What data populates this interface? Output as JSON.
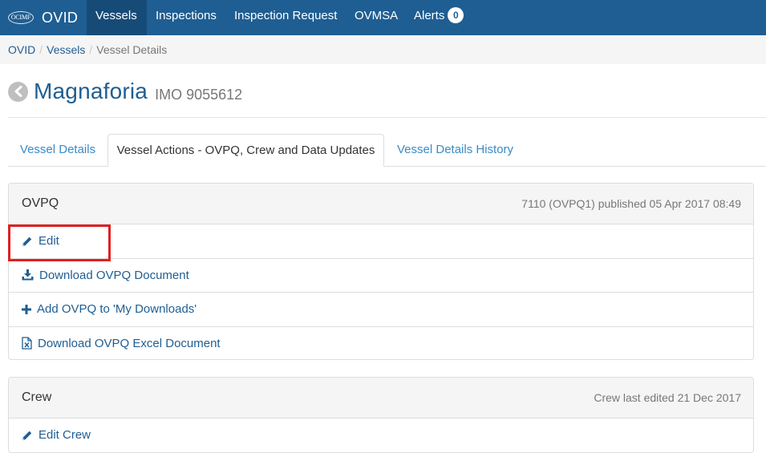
{
  "brand": {
    "logo_text": "OCIMF",
    "name": "OVID"
  },
  "nav": {
    "items": [
      {
        "label": "Vessels"
      },
      {
        "label": "Inspections"
      },
      {
        "label": "Inspection Request"
      },
      {
        "label": "OVMSA"
      },
      {
        "label": "Alerts"
      }
    ],
    "alerts_count": "0"
  },
  "breadcrumb": {
    "items": [
      "OVID",
      "Vessels"
    ],
    "current": "Vessel Details"
  },
  "vessel": {
    "name": "Magnaforia",
    "imo": "IMO 9055612"
  },
  "tabs": [
    {
      "label": "Vessel Details"
    },
    {
      "label": "Vessel Actions - OVPQ, Crew and Data Updates"
    },
    {
      "label": "Vessel Details History"
    }
  ],
  "ovpq": {
    "title": "OVPQ",
    "meta": "7110 (OVPQ1) published 05 Apr 2017 08:49",
    "actions": [
      {
        "label": "Edit",
        "icon": "pencil-icon"
      },
      {
        "label": "Download OVPQ Document",
        "icon": "download-icon"
      },
      {
        "label": "Add OVPQ to 'My Downloads'",
        "icon": "plus-icon"
      },
      {
        "label": "Download OVPQ Excel Document",
        "icon": "excel-file-icon"
      }
    ]
  },
  "crew": {
    "title": "Crew",
    "meta": "Crew last edited 21 Dec 2017",
    "actions": [
      {
        "label": "Edit Crew",
        "icon": "pencil-icon"
      }
    ]
  },
  "colors": {
    "navbar": "#1f5e92",
    "navbar_active": "#174b77",
    "link": "#1f5e92",
    "tab_link": "#3a8bc6",
    "highlight": "#e02020"
  }
}
